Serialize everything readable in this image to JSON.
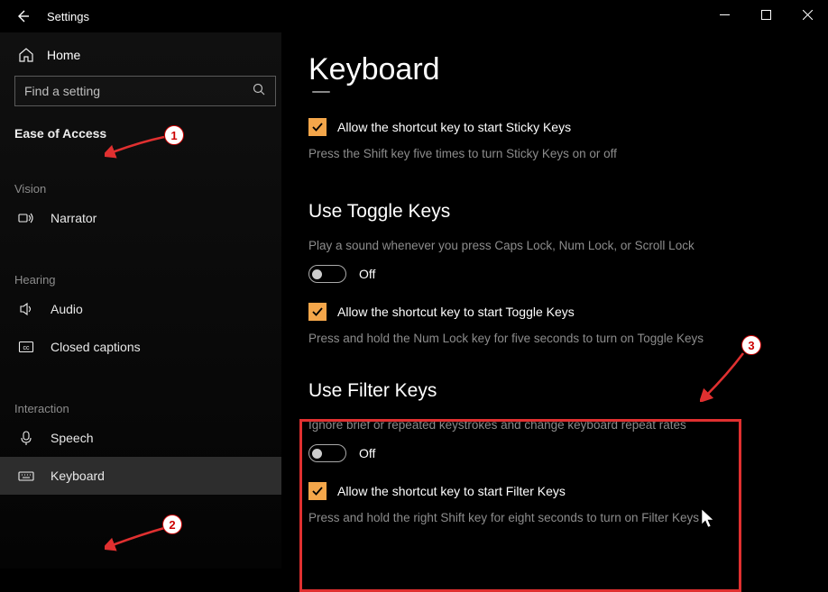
{
  "window": {
    "title": "Settings"
  },
  "sidebar": {
    "home": "Home",
    "search_placeholder": "Find a setting",
    "category": "Ease of Access",
    "groups": {
      "vision": {
        "label": "Vision",
        "items": [
          {
            "label": "Narrator"
          }
        ]
      },
      "hearing": {
        "label": "Hearing",
        "items": [
          {
            "label": "Audio"
          },
          {
            "label": "Closed captions"
          }
        ]
      },
      "interaction": {
        "label": "Interaction",
        "items": [
          {
            "label": "Speech"
          },
          {
            "label": "Keyboard"
          }
        ]
      }
    }
  },
  "main": {
    "title": "Keyboard",
    "sticky": {
      "chk_label": "Allow the shortcut key to start Sticky Keys",
      "desc": "Press the Shift key five times to turn Sticky Keys on or off"
    },
    "toggle_keys": {
      "heading": "Use Toggle Keys",
      "desc1": "Play a sound whenever you press Caps Lock, Num Lock, or Scroll Lock",
      "state": "Off",
      "chk_label": "Allow the shortcut key to start Toggle Keys",
      "desc2": "Press and hold the Num Lock key for five seconds to turn on Toggle Keys"
    },
    "filter_keys": {
      "heading": "Use Filter Keys",
      "desc1": "Ignore brief or repeated keystrokes and change keyboard repeat rates",
      "state": "Off",
      "chk_label": "Allow the shortcut key to start Filter Keys",
      "desc2": "Press and hold the right Shift key for eight seconds to turn on Filter Keys"
    }
  },
  "annotations": {
    "b1": "1",
    "b2": "2",
    "b3": "3"
  }
}
